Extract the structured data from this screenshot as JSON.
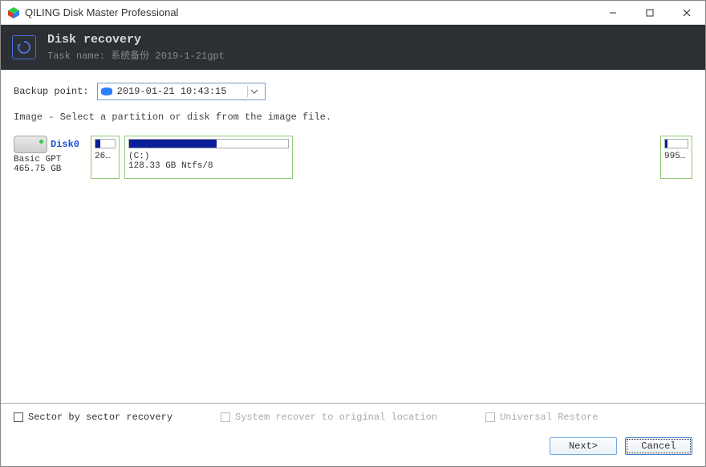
{
  "app_title": "QILING Disk Master Professional",
  "header": {
    "title": "Disk recovery",
    "task_label": "Task name:",
    "task_name": "系统备份 2019-1-21gpt"
  },
  "backup_point": {
    "label": "Backup point:",
    "selected": "2019-01-21 10:43:15"
  },
  "instruction": "Image - Select a partition or disk from the image file.",
  "disk": {
    "name": "Disk0",
    "type": "Basic GPT",
    "size": "465.75 GB",
    "partitions": [
      {
        "label": "26...",
        "usage_pct": 25
      },
      {
        "label_line1": "(C:)",
        "label_line2": "128.33 GB Ntfs/8",
        "usage_pct": 55
      },
      {
        "label": "995...",
        "usage_pct": 10
      }
    ]
  },
  "options": {
    "sector": "Sector by sector recovery",
    "system_recover": "System recover to original location",
    "universal": "Universal Restore"
  },
  "buttons": {
    "next": "Next>",
    "cancel": "Cancel"
  }
}
